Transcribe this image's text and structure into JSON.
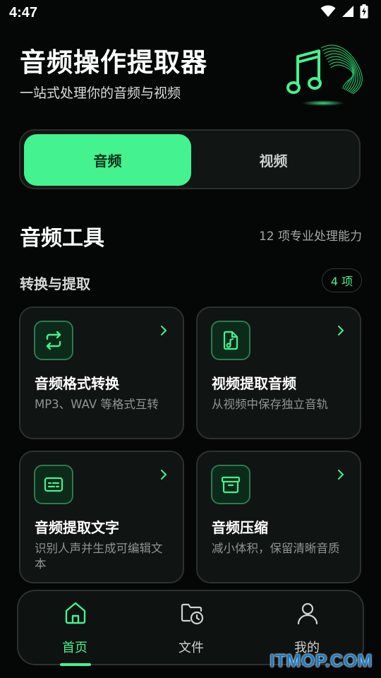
{
  "status": {
    "time": "4:47"
  },
  "header": {
    "title": "音频操作提取器",
    "subtitle": "一站式处理你的音频与视频"
  },
  "segments": [
    {
      "label": "音频",
      "active": true
    },
    {
      "label": "视频",
      "active": false
    }
  ],
  "section": {
    "title": "音频工具",
    "count": "12 项专业处理能力"
  },
  "group": {
    "title": "转换与提取",
    "badge": "4 项"
  },
  "cards": [
    {
      "title": "音频格式转换",
      "desc": "MP3、WAV 等格式互转",
      "icon": "convert-icon"
    },
    {
      "title": "视频提取音频",
      "desc": "从视频中保存独立音轨",
      "icon": "audio-file-icon"
    },
    {
      "title": "音频提取文字",
      "desc": "识别人声并生成可编辑文本",
      "icon": "subtitles-icon"
    },
    {
      "title": "音频压缩",
      "desc": "减小体积，保留清晰音质",
      "icon": "archive-icon"
    }
  ],
  "nav": [
    {
      "label": "首页",
      "icon": "home-icon",
      "active": true
    },
    {
      "label": "文件",
      "icon": "folder-clock-icon",
      "active": false
    },
    {
      "label": "我的",
      "icon": "user-icon",
      "active": false
    }
  ],
  "watermark": "ITMOP.COM",
  "colors": {
    "accent": "#44f28f",
    "background": "#050706",
    "card": "#101413"
  }
}
